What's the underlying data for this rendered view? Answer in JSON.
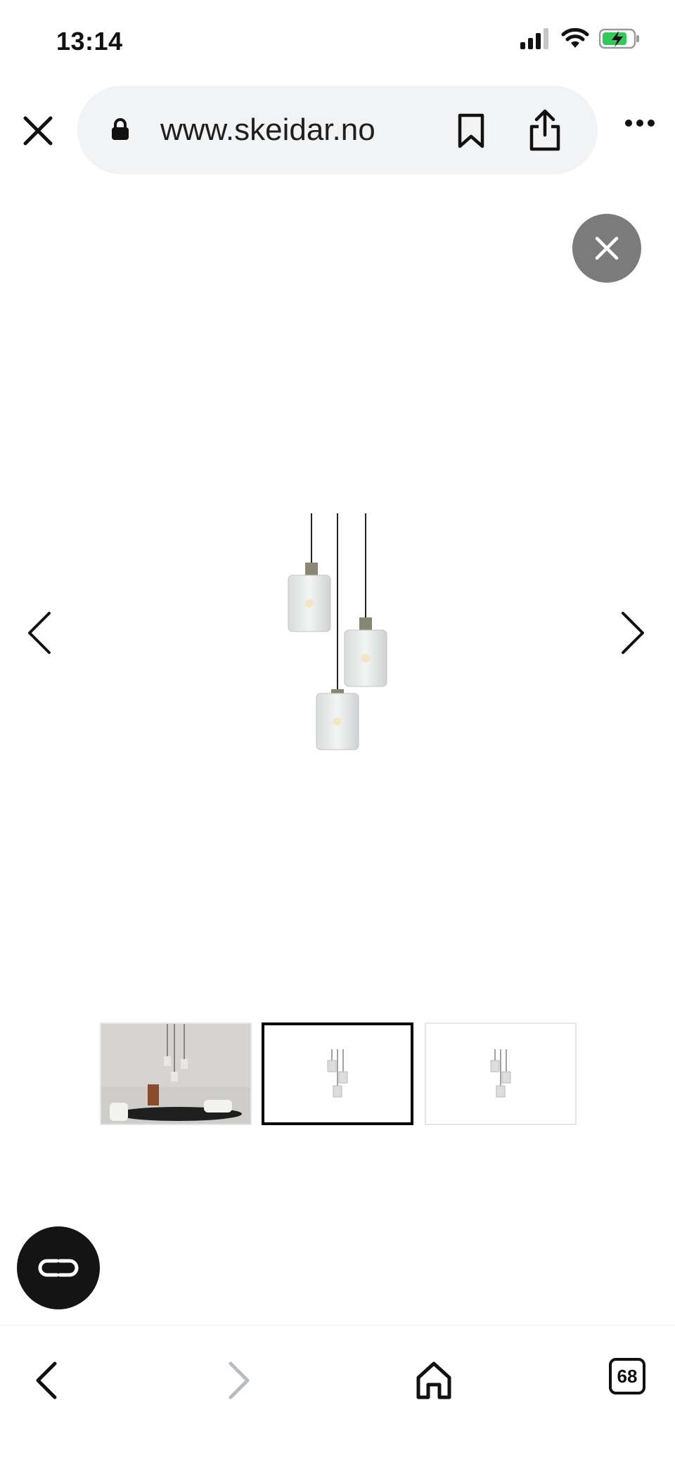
{
  "status_bar": {
    "time": "13:14",
    "icons": [
      "cellular-signal-icon",
      "wifi-icon",
      "battery-charging-icon"
    ],
    "battery_color": "#34c759"
  },
  "browser": {
    "url": "www.skeidar.no",
    "tab_count": "68",
    "icons": [
      "close-icon",
      "lock-icon",
      "bookmark-icon",
      "share-icon",
      "more-icon",
      "back-icon",
      "forward-icon",
      "home-icon"
    ]
  },
  "gallery": {
    "main_image": "pendant-lamp-three-glass-shades",
    "thumbnails": [
      {
        "name": "dining-room-lamp-photo",
        "selected": false
      },
      {
        "name": "pendant-lamp-product",
        "selected": true
      },
      {
        "name": "pendant-lamp-product-alt",
        "selected": false
      }
    ]
  },
  "fab": {
    "icon": "link-icon",
    "color": "#141414"
  }
}
